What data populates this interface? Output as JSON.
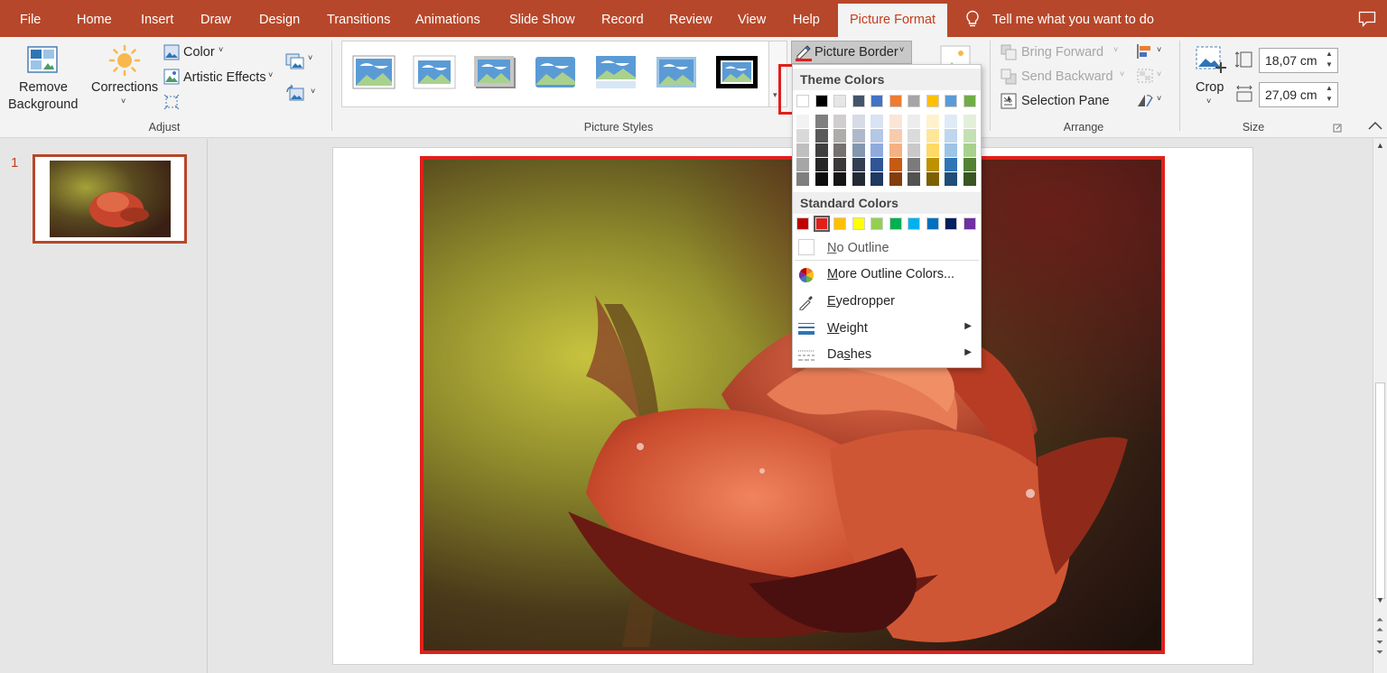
{
  "tabs": [
    {
      "label": "File",
      "active": false
    },
    {
      "label": "Home",
      "active": false
    },
    {
      "label": "Insert",
      "active": false
    },
    {
      "label": "Draw",
      "active": false
    },
    {
      "label": "Design",
      "active": false
    },
    {
      "label": "Transitions",
      "active": false
    },
    {
      "label": "Animations",
      "active": false
    },
    {
      "label": "Slide Show",
      "active": false
    },
    {
      "label": "Record",
      "active": false
    },
    {
      "label": "Review",
      "active": false
    },
    {
      "label": "View",
      "active": false
    },
    {
      "label": "Help",
      "active": false
    },
    {
      "label": "Picture Format",
      "active": true
    }
  ],
  "tell_me": "Tell me what you want to do",
  "ribbon": {
    "adjust": {
      "remove_background_line1": "Remove",
      "remove_background_line2": "Background",
      "corrections": "Corrections",
      "color": "Color",
      "artistic_effects": "Artistic Effects",
      "group_label": "Adjust"
    },
    "picture_styles": {
      "group_label": "Picture Styles",
      "picture_border": "Picture Border"
    },
    "arrange": {
      "bring_forward": "Bring Forward",
      "send_backward": "Send Backward",
      "selection_pane": "Selection Pane",
      "group_label": "Arrange"
    },
    "size": {
      "crop": "Crop",
      "height": "18,07 cm",
      "width": "27,09 cm",
      "group_label": "Size"
    }
  },
  "thumbnail_pane": {
    "slide_number": "1"
  },
  "dropdown": {
    "theme_colors_label": "Theme Colors",
    "theme_top_row": [
      "#ffffff",
      "#000000",
      "#e7e6e6",
      "#44546a",
      "#4472c4",
      "#ed7d31",
      "#a5a5a5",
      "#ffc000",
      "#5b9bd5",
      "#70ad47"
    ],
    "theme_shades": [
      [
        "#f2f2f2",
        "#7f7f7f",
        "#d0cece",
        "#d6dce5",
        "#dae3f3",
        "#fbe5d6",
        "#ededed",
        "#fff2cc",
        "#deebf7",
        "#e2f0d9"
      ],
      [
        "#d9d9d9",
        "#595959",
        "#aeabab",
        "#adb9ca",
        "#b4c7e7",
        "#f8cbad",
        "#dbdbdb",
        "#ffe699",
        "#bdd7ee",
        "#c5e0b4"
      ],
      [
        "#bfbfbf",
        "#3f3f3f",
        "#757171",
        "#8497b0",
        "#8faadc",
        "#f4b183",
        "#c9c9c9",
        "#ffd966",
        "#9dc3e6",
        "#a9d18e"
      ],
      [
        "#a6a6a6",
        "#262626",
        "#3a3838",
        "#333f50",
        "#2f5597",
        "#c55a11",
        "#7b7b7b",
        "#bf9000",
        "#2e75b6",
        "#538135"
      ],
      [
        "#7f7f7f",
        "#0d0d0d",
        "#171616",
        "#222a35",
        "#1f3864",
        "#843c0c",
        "#525252",
        "#7f6000",
        "#1f4e79",
        "#385723"
      ]
    ],
    "standard_colors_label": "Standard Colors",
    "standard_colors": [
      "#c00000",
      "#e0201b",
      "#ffc000",
      "#ffff00",
      "#92d050",
      "#00b050",
      "#00b0f0",
      "#0070c0",
      "#002060",
      "#7030a0"
    ],
    "selected_standard_index": 1,
    "no_outline": "No Outline",
    "more_outline_colors": "More Outline Colors...",
    "eyedropper": "Eyedropper",
    "weight": "Weight",
    "dashes": "Dashes"
  },
  "colors": {
    "accent": "#b7472a",
    "active_tab_text": "#c43e1c",
    "border_red": "#e0201b"
  }
}
